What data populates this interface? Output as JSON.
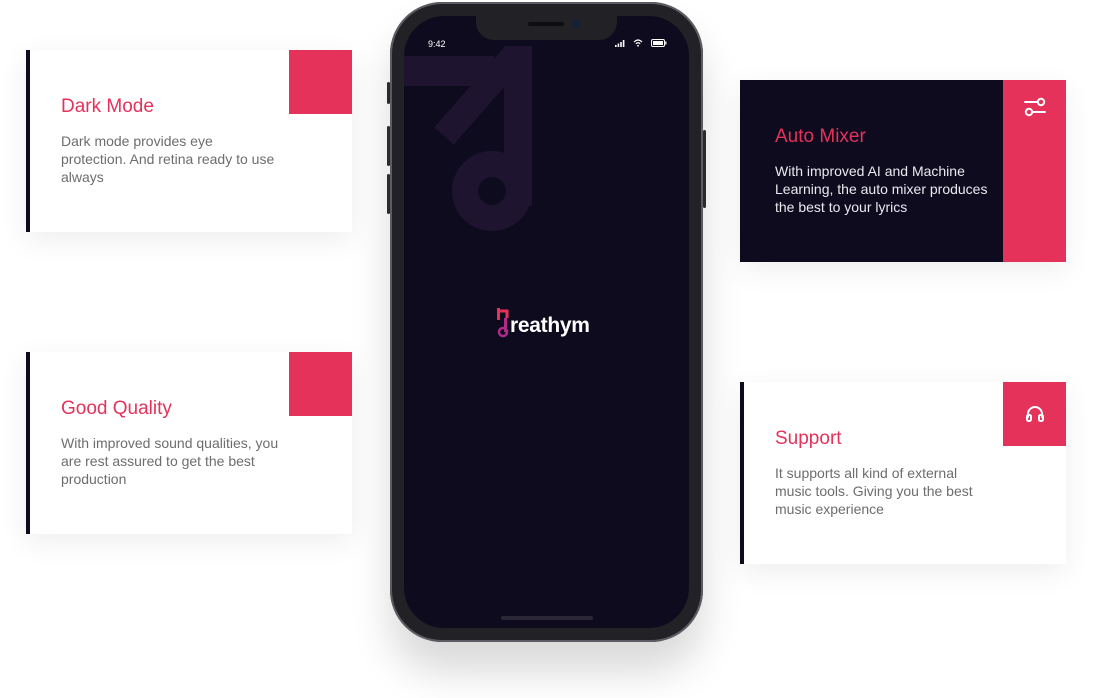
{
  "features": {
    "dark_mode": {
      "title": "Dark Mode",
      "description": "Dark mode provides eye protection. And retina ready to use always"
    },
    "good_quality": {
      "title": "Good Quality",
      "description": "With improved sound qualities, you are rest assured to get the best production"
    },
    "auto_mixer": {
      "title": "Auto Mixer",
      "description": "With improved AI and Machine Learning, the auto mixer produces the best to your lyrics",
      "icon": "sliders-icon"
    },
    "support": {
      "title": "Support",
      "description": "It supports all kind of external music tools. Giving you the best music experience",
      "icon": "headphones-icon"
    }
  },
  "phone": {
    "status_time": "9:42",
    "status_icons": [
      "signal-icon",
      "wifi-icon",
      "battery-icon"
    ],
    "app_name": "reathym",
    "background_icon": "music-note-icon"
  },
  "colors": {
    "accent": "#e5325a",
    "dark": "#0f0b1f",
    "white": "#ffffff"
  }
}
